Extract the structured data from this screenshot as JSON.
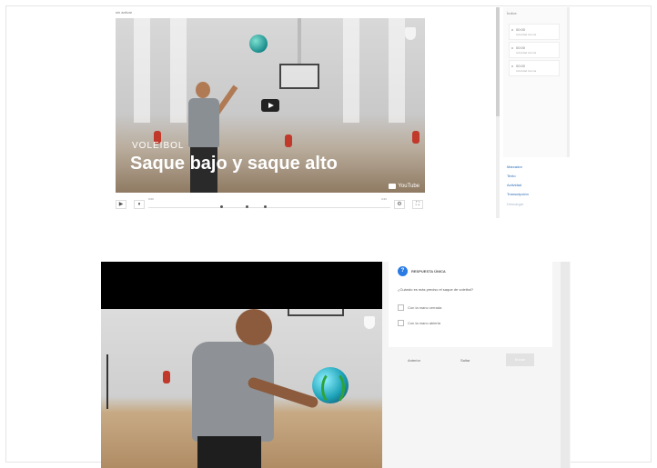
{
  "top": {
    "caption": "sin activar",
    "video": {
      "category": "VOLEIBOL",
      "title": "Saque bajo y saque alto",
      "watermark": "YouTube"
    },
    "controls": {
      "time_start": "0:00",
      "time_end": "3:23",
      "play": "▶",
      "pause": "⏸",
      "settings": "⚙",
      "fullscreen": "⛶"
    },
    "sidebar": {
      "label": "Índice",
      "cards": [
        {
          "time": "00:00",
          "subtitle": "Actividad interna"
        },
        {
          "time": "00:00",
          "subtitle": "Actividad interna"
        },
        {
          "time": "00:00",
          "subtitle": "Actividad interna"
        }
      ],
      "links": [
        "Marcador",
        "Texto",
        "Actividad",
        "Transcripción",
        "Descargar"
      ]
    }
  },
  "bottom": {
    "quiz": {
      "icon_label": "?",
      "header": "RESPUESTA ÚNICA",
      "question": "¿Cuándo es más preciso el saque de voleibol?",
      "options": [
        "Con la mano cerrada",
        "Con la mano abierta"
      ],
      "back": "Anterior",
      "skip": "Saltar",
      "submit": "Enviar"
    }
  }
}
